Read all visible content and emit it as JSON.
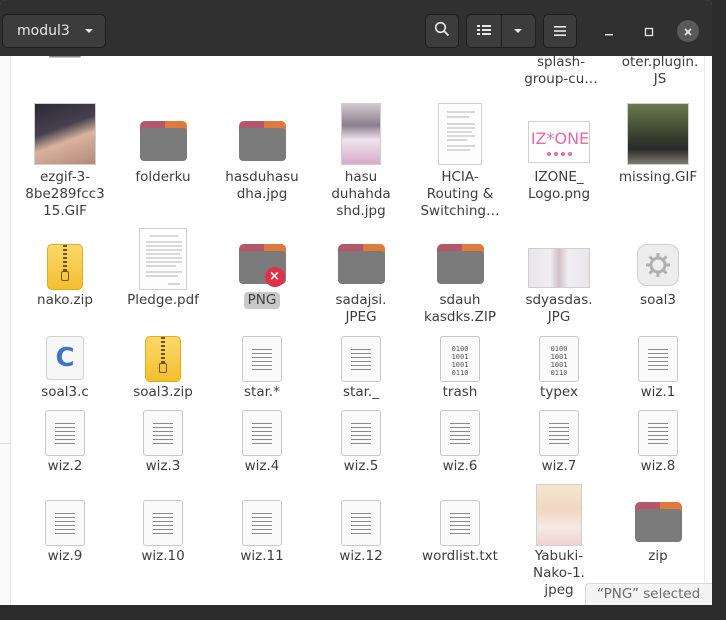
{
  "header": {
    "path_label": "modul3",
    "icons": {
      "chevron": "chevron-down-icon",
      "search": "search-icon",
      "list_view": "list-view-icon",
      "sort": "view-options-chevron-icon",
      "menu": "hamburger-menu-icon",
      "minimize": "minimize-icon",
      "maximize": "maximize-icon",
      "close": "close-icon"
    }
  },
  "files": {
    "top_cut": [
      {
        "label": "",
        "icon": "unknown"
      },
      {
        "label": "",
        "icon": "unknown"
      },
      {
        "label": "",
        "icon": "unknown"
      },
      {
        "label": "",
        "icon": "unknown"
      },
      {
        "label": "",
        "icon": "unknown"
      },
      {
        "label": "splash-\ngroup-cu…",
        "icon": "image"
      },
      {
        "label": "oter.plugin.\nJS",
        "icon": "image"
      }
    ],
    "row1": [
      {
        "label": "ezgif-3-\n8be289fcc3\n15.GIF",
        "icon": "image-thumbnail"
      },
      {
        "label": "folderku",
        "icon": "folder-icon"
      },
      {
        "label": "hasduhasu\ndha.jpg",
        "icon": "folder-icon"
      },
      {
        "label": "hasu\nduhahda\nshd.jpg",
        "icon": "image-thumbnail"
      },
      {
        "label": "HCIA-\nRouting &\nSwitching…",
        "icon": "document-thumbnail"
      },
      {
        "label": "IZONE_\nLogo.png",
        "icon": "image-thumbnail"
      },
      {
        "label": "missing.GIF",
        "icon": "image-thumbnail"
      }
    ],
    "row2": [
      {
        "label": "nako.zip",
        "icon": "zip-icon"
      },
      {
        "label": "Pledge.pdf",
        "icon": "document-thumbnail"
      },
      {
        "label": "PNG",
        "icon": "folder-broken-icon",
        "selected": true
      },
      {
        "label": "sadajsi.\nJPEG",
        "icon": "folder-icon"
      },
      {
        "label": "sdauh\nkasdks.ZIP",
        "icon": "folder-icon"
      },
      {
        "label": "sdyasdas.\nJPG",
        "icon": "image-thumbnail"
      },
      {
        "label": "soal3",
        "icon": "executable-gear-icon"
      }
    ],
    "row3": [
      {
        "label": "soal3.c",
        "icon": "c-source-icon"
      },
      {
        "label": "soal3.zip",
        "icon": "zip-icon"
      },
      {
        "label": "star.*",
        "icon": "text-file-icon"
      },
      {
        "label": "star._",
        "icon": "text-file-icon"
      },
      {
        "label": "trash",
        "icon": "binary-file-icon"
      },
      {
        "label": "typex",
        "icon": "binary-file-icon"
      },
      {
        "label": "wiz.1",
        "icon": "text-file-icon"
      }
    ],
    "row4": [
      {
        "label": "wiz.2",
        "icon": "text-file-icon"
      },
      {
        "label": "wiz.3",
        "icon": "text-file-icon"
      },
      {
        "label": "wiz.4",
        "icon": "text-file-icon"
      },
      {
        "label": "wiz.5",
        "icon": "text-file-icon"
      },
      {
        "label": "wiz.6",
        "icon": "text-file-icon"
      },
      {
        "label": "wiz.7",
        "icon": "text-file-icon"
      },
      {
        "label": "wiz.8",
        "icon": "text-file-icon"
      }
    ],
    "row5": [
      {
        "label": "wiz.9",
        "icon": "text-file-icon"
      },
      {
        "label": "wiz.10",
        "icon": "text-file-icon"
      },
      {
        "label": "wiz.11",
        "icon": "text-file-icon"
      },
      {
        "label": "wiz.12",
        "icon": "text-file-icon"
      },
      {
        "label": "wordlist.txt",
        "icon": "text-file-icon"
      },
      {
        "label": "Yabuki-\nNako-1.\njpeg",
        "icon": "image-thumbnail"
      },
      {
        "label": "zip",
        "icon": "folder-icon"
      }
    ]
  },
  "binary_glyphs": "0100\n1001\n1001\n0110",
  "status": {
    "text": "“PNG” selected"
  },
  "colors": {
    "header_bg": "#303030",
    "folder_body": "#7b7b7b",
    "folder_tab_left": "#b5576a",
    "folder_tab_right": "#e07a3c",
    "error_badge": "#e0314a",
    "selection": "#c9c9c9"
  }
}
